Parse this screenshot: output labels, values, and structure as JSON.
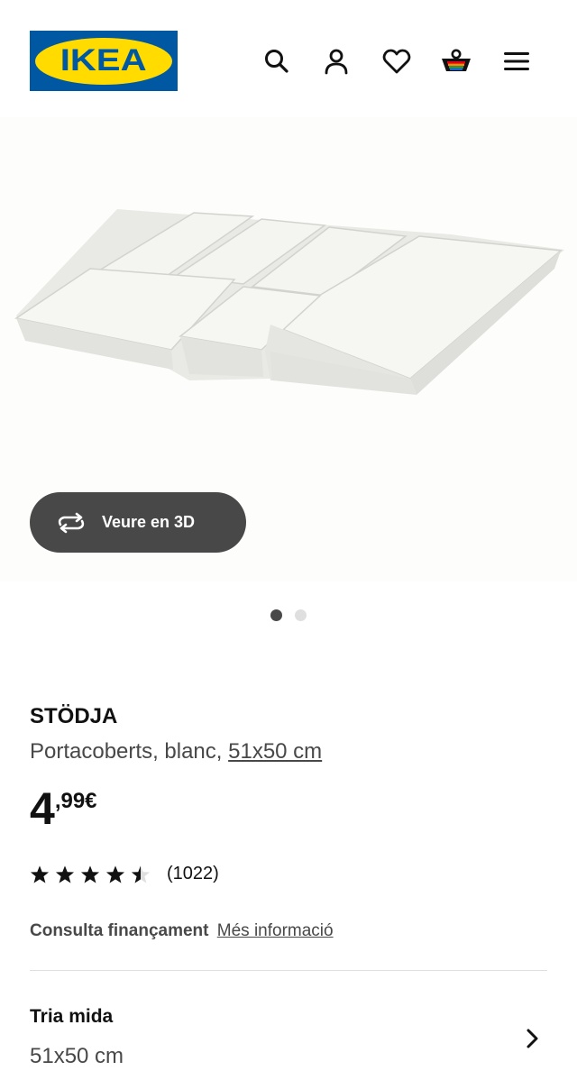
{
  "brand": {
    "logo_text": "IKEA"
  },
  "header": {
    "icons": [
      "search-icon",
      "user-icon",
      "heart-icon",
      "basket-icon",
      "menu-icon"
    ]
  },
  "gallery": {
    "view3d_label": "Veure en 3D",
    "active_index": 0,
    "count": 2
  },
  "product": {
    "name": "STÖDJA",
    "description_prefix": "Portacoberts, blanc, ",
    "size_link": "51x50 cm",
    "price_integer": "4",
    "price_decimal": ",99€",
    "rating": {
      "stars": 4.5,
      "count_label": "(1022)"
    },
    "finance_label": "Consulta finançament",
    "finance_link": "Més informació"
  },
  "size_selector": {
    "title": "Tria mida",
    "value": "51x50 cm"
  },
  "colors": {
    "ikea_blue": "#0058a3",
    "ikea_yellow": "#ffdb00",
    "dark_button": "#484848"
  }
}
